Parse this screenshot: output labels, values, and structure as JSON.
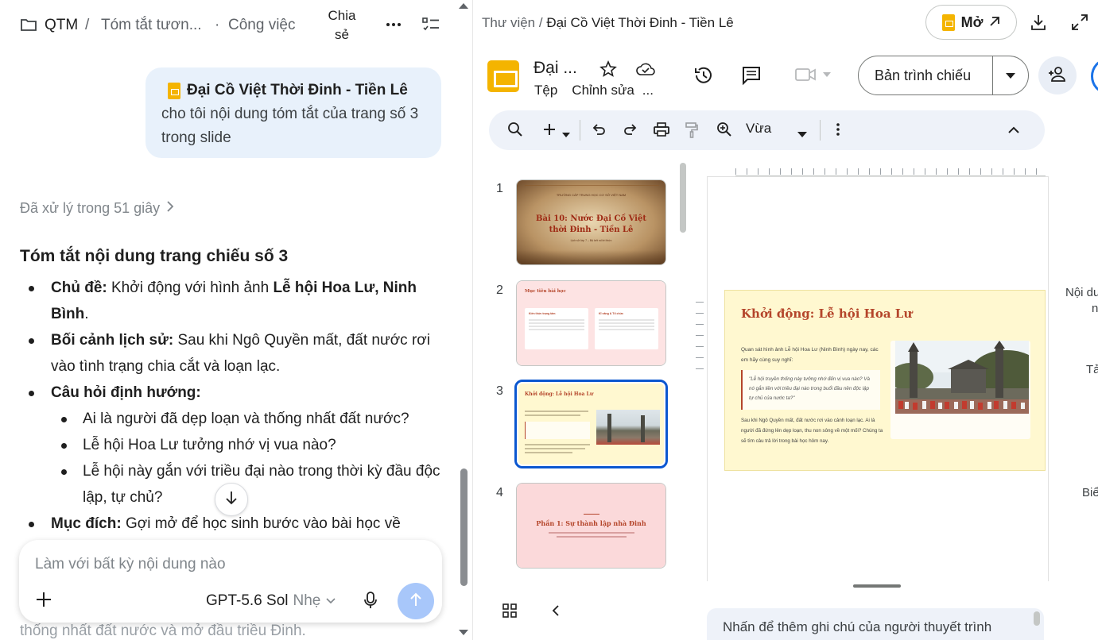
{
  "chat": {
    "header": {
      "workspace": "QTM",
      "separator": "/",
      "conversation": "Tóm tắt tươn...",
      "dot": "·",
      "project": "Công việc",
      "share_line1": "Chia",
      "share_line2": "sẻ"
    },
    "user_message": {
      "file_name": "Đại Cồ Việt Thời Đinh - Tiền Lê",
      "text": "cho tôi nội dung tóm tắt của trang số 3 trong slide"
    },
    "processed_label": "Đã xử lý trong 51 giây",
    "summary_title": "Tóm tắt nội dung trang chiếu số 3",
    "bullets": {
      "topic_label": "Chủ đề:",
      "topic_text": " Khởi động với hình ảnh ",
      "topic_bold": "Lễ hội Hoa Lư, Ninh Bình",
      "topic_end": ".",
      "context_label": "Bối cảnh lịch sử:",
      "context_text": " Sau khi Ngô Quyền mất, đất nước rơi vào tình trạng chia cắt và loạn lạc.",
      "questions_label": "Câu hỏi định hướng:",
      "questions": [
        "Ai là người đã dẹp loạn và thống nhất đất nước?",
        "Lễ hội Hoa Lư tưởng nhớ vị vua nào?",
        "Lễ hội này gắn với triều đại nào trong thời kỳ đầu độc lập, tự chủ?"
      ],
      "purpose_label": "Mục đích:",
      "purpose_text": " Gợi mở để học sinh bước vào bài học về"
    },
    "faded_line": "thống nhất đất nước và mở đầu triều Đinh.",
    "composer": {
      "placeholder": "Làm với bất kỳ nội dung nào",
      "model": "GPT-5.6 Sol",
      "model_mode": "Nhẹ"
    }
  },
  "slides_app": {
    "breadcrumb_root": "Thư viện",
    "breadcrumb_sep": " / ",
    "breadcrumb_current": "Đại Cồ Việt Thời Đinh - Tiền Lê",
    "open_label": "Mở",
    "doc_title": "Đại ...",
    "menu": [
      "Tệp",
      "Chỉnh sửa",
      "..."
    ],
    "present_label": "Bản trình chiếu",
    "zoom_label": "Vừa",
    "slide_numbers": [
      "1",
      "2",
      "3",
      "4"
    ],
    "thumb1": {
      "kicker": "TRƯỜNG CÁP TRUNG HỌC CƠ SỞ VIỆT NAM",
      "title_line1": "Bài 10: Nước Đại Cồ Việt",
      "title_line2": "thời Đinh - Tiền Lê",
      "sub": "Lịch sử lớp 7 – Bộ kết nối tri thức"
    },
    "thumb2": {
      "title": "Mục tiêu bài học",
      "card1_title": "Kiến thức trọng tâm",
      "card2_title": "Kĩ năng & Tổ chức"
    },
    "thumb4": {
      "title": "Phần 1: Sự thành lập nhà Đinh"
    },
    "main_slide": {
      "title": "Khởi động: Lễ hội Hoa Lư",
      "p1": "Quan sát hình ảnh Lễ hội Hoa Lư (Ninh Bình) ngày nay, các em hãy cùng suy nghĩ:",
      "quote": "\"Lễ hội truyền thống này tưởng nhớ đến vị vua nào? Và nó gắn liền với triều đại nào trong buổi đầu nền độc lập tự chủ của nước ta?\"",
      "p2": "Sau khi Ngô Quyền mất, đất nước rơi vào cảnh loạn lạc. Ai là người đã đứng lên dẹp loạn, thu non sông về một mối? Chúng ta sẽ tìm câu trả lời trong bài học hôm nay."
    },
    "right_cut": [
      "Nội du",
      "n",
      "Tả",
      "Biể"
    ],
    "notes_placeholder": "Nhấn để thêm ghi chú của người thuyết trình"
  },
  "colors": {
    "accent_blue": "#0b57d0",
    "slides_yellow": "#f4b400",
    "bubble_bg": "#e8f1fb",
    "slide_title_red": "#b4452a"
  }
}
